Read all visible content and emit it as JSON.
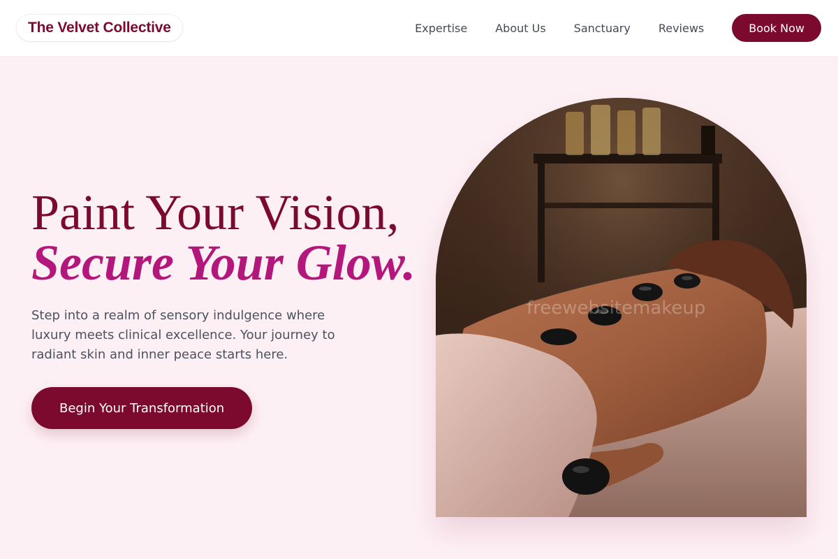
{
  "header": {
    "logo": "The Velvet Collective",
    "nav": [
      "Expertise",
      "About Us",
      "Sanctuary",
      "Reviews"
    ],
    "book_label": "Book Now"
  },
  "hero": {
    "headline_line1": "Paint Your Vision,",
    "headline_line2": "Secure Your Glow.",
    "lead": "Step into a realm of sensory indulgence where luxury meets clinical excellence. Your journey to radiant skin and inner peace starts here.",
    "cta_label": "Begin Your Transformation",
    "image_watermark": "freewebsitemakeup"
  },
  "colors": {
    "brand": "#7b0a2e",
    "accent": "#b4177c",
    "background": "#fdf0f4"
  }
}
